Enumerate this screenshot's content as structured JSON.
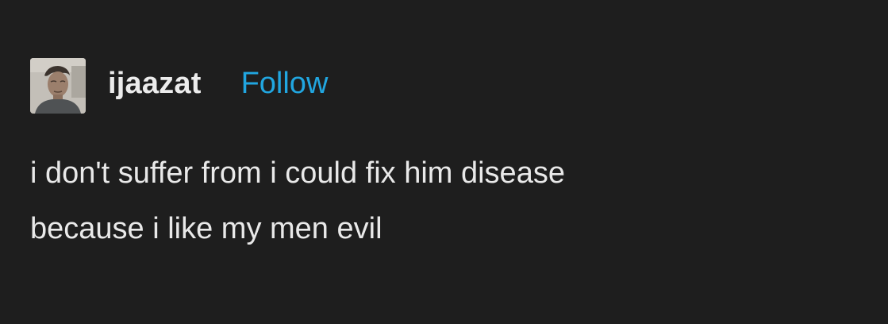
{
  "post": {
    "author": {
      "username": "ijaazat",
      "follow_label": "Follow",
      "avatar_icon": "user-avatar-photo"
    },
    "body": {
      "lines": [
        "i don't suffer from i could fix him disease",
        "because i like my men evil"
      ]
    }
  },
  "colors": {
    "background": "#1e1e1e",
    "text": "#e9e9e9",
    "follow_accent": "#21a6e0"
  }
}
